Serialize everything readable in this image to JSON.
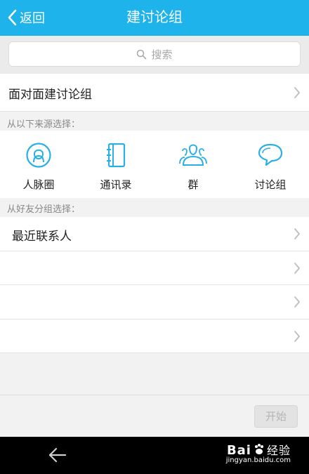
{
  "header": {
    "back_label": "返回",
    "title": "建讨论组"
  },
  "search": {
    "placeholder": "搜索"
  },
  "face_to_face": {
    "label": "面对面建讨论组"
  },
  "sources": {
    "section_label": "从以下来源选择：",
    "items": [
      {
        "label": "人脉圈",
        "icon": "contacts-circle-icon"
      },
      {
        "label": "通讯录",
        "icon": "address-book-icon"
      },
      {
        "label": "群",
        "icon": "group-icon"
      },
      {
        "label": "讨论组",
        "icon": "discussion-bubble-icon"
      }
    ]
  },
  "friend_groups": {
    "section_label": "从好友分组选择：",
    "items": [
      {
        "label": "最近联系人"
      },
      {
        "label": ""
      },
      {
        "label": ""
      },
      {
        "label": ""
      }
    ]
  },
  "footer": {
    "start_label": "开始"
  },
  "watermark": {
    "brand": "Bai",
    "brand_suffix": "经验",
    "url": "jingyan.baidu.com"
  },
  "colors": {
    "accent": "#1fb3ec",
    "icon": "#2aaee6"
  }
}
